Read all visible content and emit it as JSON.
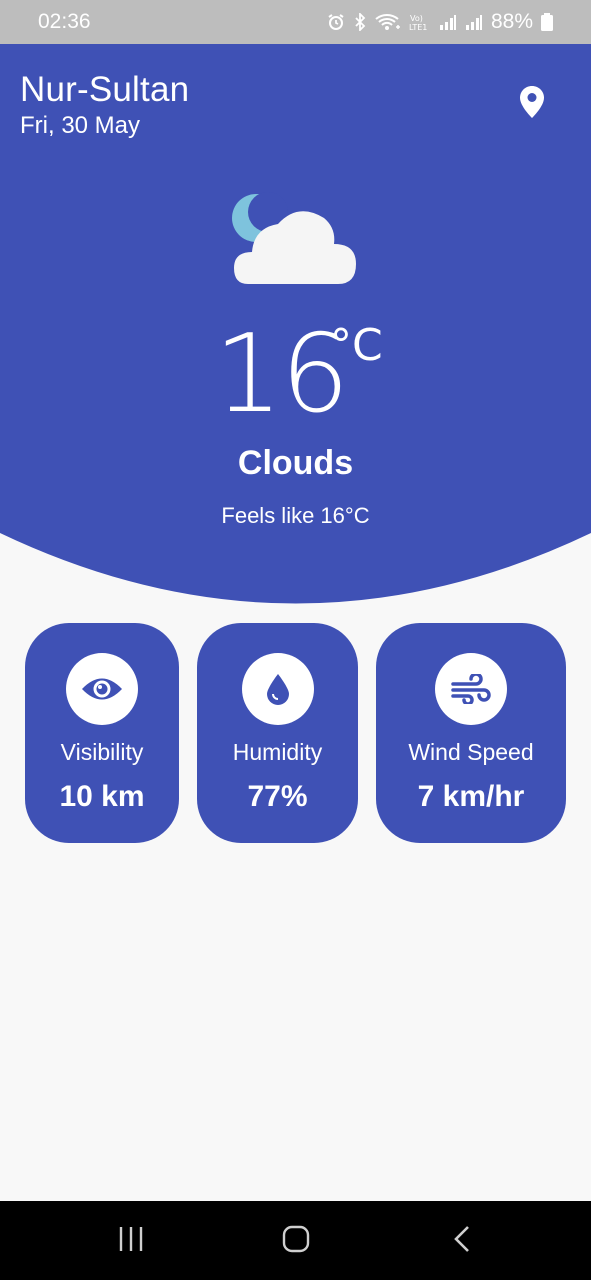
{
  "status_bar": {
    "time": "02:36",
    "battery": "88%",
    "icons": [
      "alarm-icon",
      "bluetooth-icon",
      "wifi-icon",
      "volte-icon",
      "signal-icon",
      "signal-icon",
      "battery-icon"
    ]
  },
  "location": {
    "city": "Nur-Sultan",
    "date": "Fri, 30 May",
    "icon": "location-pin-icon"
  },
  "current": {
    "icon": "cloud-moon-icon",
    "temperature": "16",
    "unit": "°C",
    "condition": "Clouds",
    "feels_like": "Feels like 16°C"
  },
  "details": [
    {
      "icon": "eye-icon",
      "label": "Visibility",
      "value": "10 km"
    },
    {
      "icon": "water-drop-icon",
      "label": "Humidity",
      "value": "77%"
    },
    {
      "icon": "wind-icon",
      "label": "Wind Speed",
      "value": "7 km/hr"
    }
  ],
  "nav": {
    "buttons": [
      "recent-apps-icon",
      "home-icon",
      "back-icon"
    ]
  },
  "colors": {
    "primary": "#3f51b5",
    "background": "#f8f8f8",
    "status_bar": "#bdbdbd",
    "cloud": "#f5f5f5",
    "moon": "#7ec3dd"
  }
}
